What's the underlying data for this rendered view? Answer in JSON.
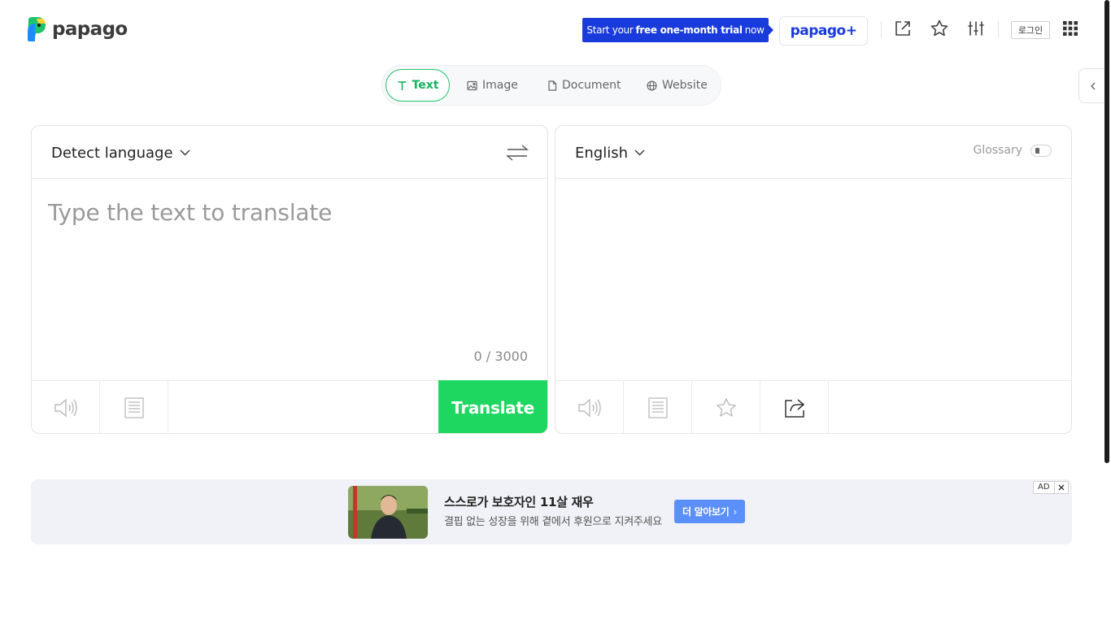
{
  "header": {
    "logo_text": "papago",
    "promo": {
      "prefix": "Start your",
      "highlight": "free one-month trial",
      "suffix": "now"
    },
    "plus_label": "papago+",
    "icons": [
      "open-new-window-icon",
      "favorites-star-icon",
      "settings-sliders-icon",
      "apps-grid-icon"
    ],
    "login_label": "로그인"
  },
  "tabs": [
    {
      "label": "Text",
      "icon": "text-icon",
      "active": true
    },
    {
      "label": "Image",
      "icon": "image-icon",
      "active": false
    },
    {
      "label": "Document",
      "icon": "document-icon",
      "active": false
    },
    {
      "label": "Website",
      "icon": "globe-icon",
      "active": false
    }
  ],
  "source": {
    "language": "Detect language",
    "placeholder": "Type the text to translate",
    "value": "",
    "char_count": "0 / 3000",
    "translate_label": "Translate"
  },
  "target": {
    "language": "English",
    "glossary_label": "Glossary",
    "glossary_on": false
  },
  "ad": {
    "title": "스스로가 보호자인 11살 재우",
    "description": "결핍 없는 성장을 위해 곁에서 후원으로 지켜주세요",
    "cta": "더 알아보기",
    "badge": "AD"
  },
  "colors": {
    "brand_green": "#1ed760",
    "tab_active_green": "#16b35e",
    "promo_blue": "#1a3bdb",
    "ad_cta_blue": "#5b8ff9"
  }
}
